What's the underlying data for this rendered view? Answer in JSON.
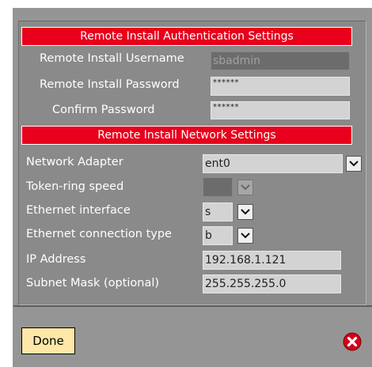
{
  "auth": {
    "header": "Remote Install Authentication Settings",
    "username_label": "Remote Install Username",
    "username_value": "sbadmin",
    "password_label": "Remote Install Password",
    "password_value": "******",
    "confirm_label": "Confirm Password",
    "confirm_value": "******"
  },
  "network": {
    "header": "Remote Install Network Settings",
    "adapter_label": "Network Adapter",
    "adapter_value": "ent0",
    "token_label": "Token-ring speed",
    "token_value": "",
    "eth_if_label": "Ethernet interface",
    "eth_if_value": "s",
    "eth_conn_label": "Ethernet connection type",
    "eth_conn_value": "b",
    "ip_label": "IP Address",
    "ip_value": "192.168.1.121",
    "mask_label": "Subnet Mask (optional)",
    "mask_value": "255.255.255.0"
  },
  "footer": {
    "done_label": "Done",
    "close_icon": "close-icon"
  },
  "colors": {
    "header_red": "#e8001c",
    "panel_gray": "#8a8a8a",
    "done_bg": "#ffe7a8"
  }
}
